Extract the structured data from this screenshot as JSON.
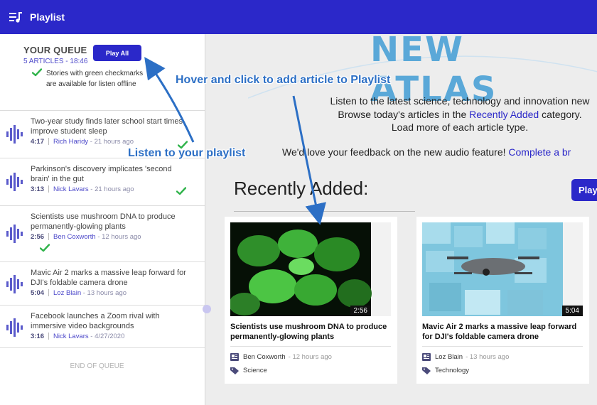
{
  "header": {
    "title": "Playlist"
  },
  "queue": {
    "title": "YOUR QUEUE",
    "count": "5 ARTICLES - 18:46",
    "play_all": "Play All",
    "note": "Stories with green checkmarks are available for listen offline",
    "end": "END OF QUEUE",
    "items": [
      {
        "title": "Two-year study finds later school start times improve student sleep",
        "duration": "4:17",
        "author": "Rich Haridy",
        "ago": " - 21 hours ago"
      },
      {
        "title": "Parkinson's discovery implicates 'second brain' in the gut",
        "duration": "3:13",
        "author": "Nick Lavars",
        "ago": " - 21 hours ago"
      },
      {
        "title": "Scientists use mushroom DNA to produce permanently-glowing plants",
        "duration": "2:56",
        "author": "Ben Coxworth",
        "ago": " - 12 hours ago"
      },
      {
        "title": "Mavic Air 2 marks a massive leap forward for DJI's foldable camera drone",
        "duration": "5:04",
        "author": "Loz Blain",
        "ago": " - 13 hours ago"
      },
      {
        "title": "Facebook launches a Zoom rival with immersive video backgrounds",
        "duration": "3:16",
        "author": "Nick Lavars",
        "ago": " - 4/27/2020"
      }
    ]
  },
  "main": {
    "logo": "NEW ATLAS",
    "intro_1": "Listen to the latest science, technology and innovation new",
    "intro_2a": "Browse today's articles in the ",
    "intro_2b": "Recently Added",
    "intro_2c": " category.",
    "intro_3": "Load more of each article type.",
    "feedback_a": "We'd love your feedback on the new audio feature! ",
    "feedback_b": "Complete a br",
    "recent_heading": "Recently Added:",
    "play_label": "Play"
  },
  "cards": [
    {
      "duration": "2:56",
      "title": "Scientists use mushroom DNA to produce permanently-glowing plants",
      "author": "Ben Coxworth",
      "ago": "- 12 hours ago",
      "category": "Science"
    },
    {
      "duration": "5:04",
      "title": "Mavic Air 2 marks a massive leap forward for DJI's foldable camera drone",
      "author": "Loz Blain",
      "ago": "- 13 hours ago",
      "category": "Technology"
    }
  ],
  "annotations": {
    "hover": "Hover and click to add article to Playlist",
    "listen": "Listen to your playlist"
  },
  "colors": {
    "brand": "#2b28c9",
    "check": "#2fb34a",
    "annotation": "#2c6fc5"
  }
}
